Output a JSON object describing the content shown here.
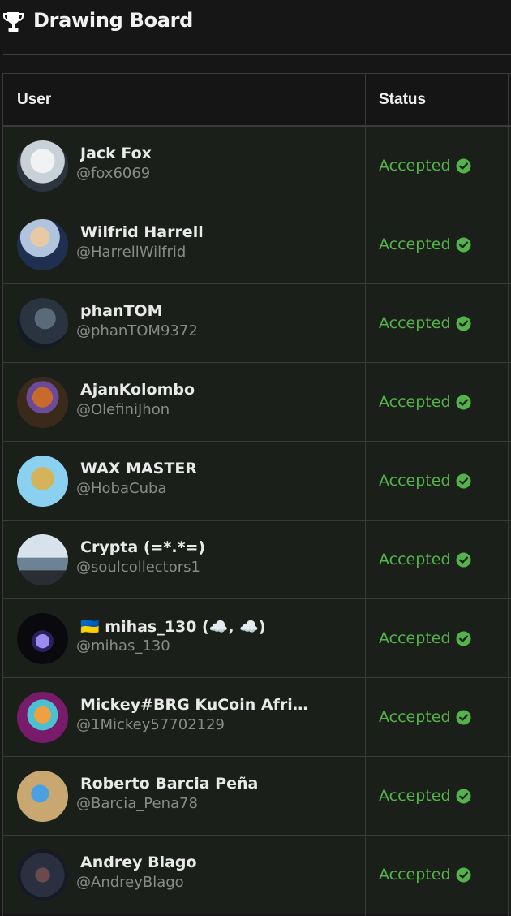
{
  "header": {
    "title": "Drawing Board",
    "icon": "trophy-icon"
  },
  "table": {
    "columns": {
      "user": "User",
      "status": "Status"
    },
    "rows": [
      {
        "name": "Jack Fox",
        "handle": "@fox6069",
        "status": "Accepted"
      },
      {
        "name": "Wilfrid Harrell",
        "handle": "@HarrellWilfrid",
        "status": "Accepted"
      },
      {
        "name": "phanTOM",
        "handle": "@phanTOM9372",
        "status": "Accepted"
      },
      {
        "name": "AjanKolombo",
        "handle": "@OlefiniJhon",
        "status": "Accepted"
      },
      {
        "name": "WAX MASTER",
        "handle": "@HobaCuba",
        "status": "Accepted"
      },
      {
        "name": "Crypta (=*.*=)",
        "handle": "@soulcollectors1",
        "status": "Accepted"
      },
      {
        "name": "🇺🇦 mihas_130 (☁️, ☁️)",
        "handle": "@mihas_130",
        "status": "Accepted"
      },
      {
        "name": "Mickey#BRG KuCoin Afri…",
        "handle": "@1Mickey57702129",
        "status": "Accepted"
      },
      {
        "name": "Roberto Barcia Peña",
        "handle": "@Barcia_Pena78",
        "status": "Accepted"
      },
      {
        "name": "Andrey Blago",
        "handle": "@AndreyBlago",
        "status": "Accepted"
      }
    ]
  },
  "colors": {
    "background": "#161616",
    "row_background": "#1a1f1a",
    "accepted": "#55b24a",
    "handle": "#8a8a8a"
  }
}
